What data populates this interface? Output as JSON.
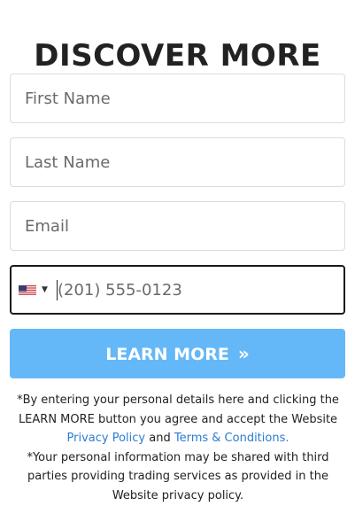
{
  "title": "DISCOVER MORE",
  "form": {
    "first_name": {
      "placeholder": "First Name",
      "value": ""
    },
    "last_name": {
      "placeholder": "Last Name",
      "value": ""
    },
    "email": {
      "placeholder": "Email",
      "value": ""
    },
    "phone": {
      "placeholder": "(201) 555-0123",
      "value": "",
      "country_flag": "us-flag-icon",
      "dropdown_icon": "caret-down-icon"
    },
    "submit": {
      "label": "LEARN MORE",
      "arrows": "»"
    }
  },
  "disclaimer": {
    "line1_pre": "*By entering your personal details here and clicking the LEARN MORE button you agree and accept the Website",
    "privacy_link": "Privacy Policy",
    "and": "and",
    "terms_link": "Terms & Conditions.",
    "line2": "*Your personal information may be shared with third parties providing trading services as provided in the Website privacy policy."
  },
  "colors": {
    "button_bg": "#64b8f8",
    "link": "#2b7cd3",
    "text": "#222222",
    "border": "#dcdcdc",
    "focus_border": "#1a1a1a"
  }
}
